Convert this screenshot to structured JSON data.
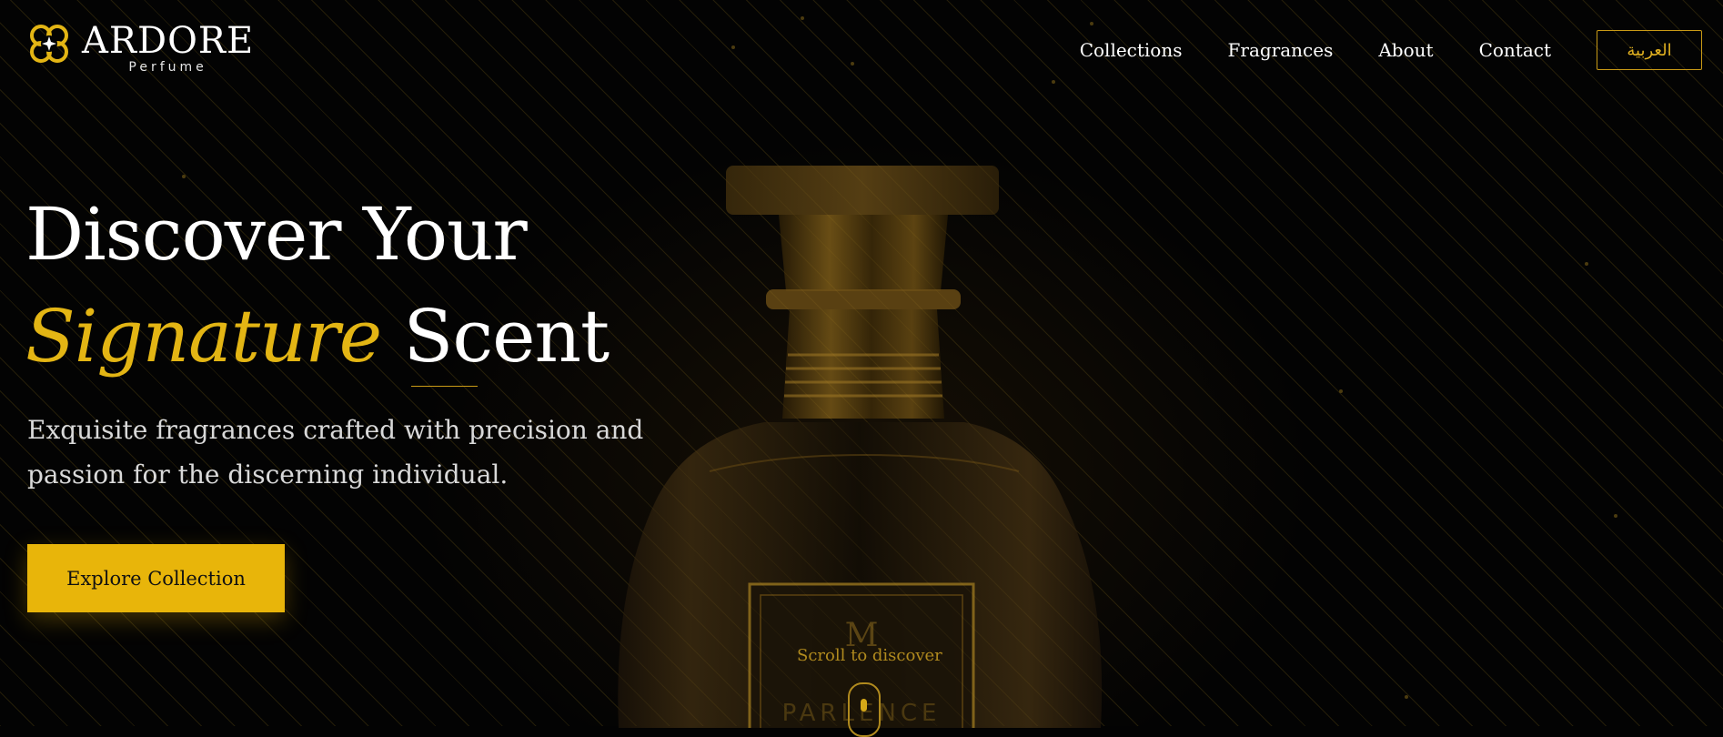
{
  "brand": {
    "name": "ARDORE",
    "subtitle": "Perfume",
    "accent_color": "#e3b514"
  },
  "nav": {
    "links": [
      "Collections",
      "Fragrances",
      "About",
      "Contact"
    ],
    "language_toggle": "العربية"
  },
  "hero": {
    "title_line1": "Discover Your",
    "title_accent": "Signature",
    "title_rest": "Scent",
    "description": "Exquisite fragrances crafted with precision and passion for the discerning individual.",
    "cta_label": "Explore Collection"
  },
  "scroll_hint": {
    "label": "Scroll to discover"
  },
  "product_visual": {
    "bottle_label_initial": "M",
    "bottle_label_text": "PARLENCE"
  }
}
